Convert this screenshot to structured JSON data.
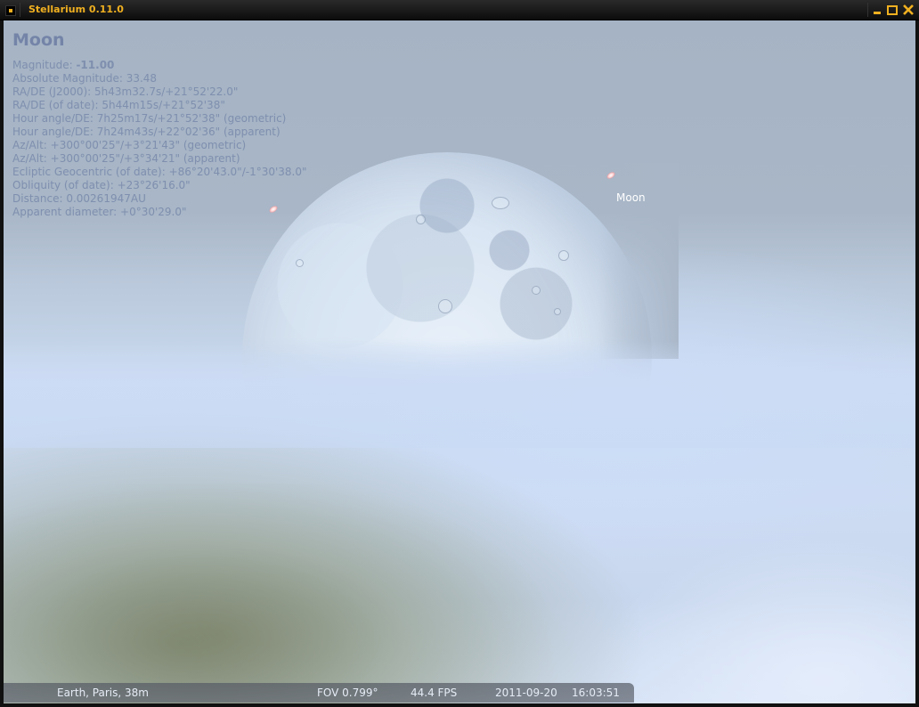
{
  "window": {
    "title": "Stellarium 0.11.0",
    "accent_color": "#f0b020",
    "icons": {
      "app": "app-menu-icon",
      "minimize": "minimize-icon",
      "maximize": "maximize-icon",
      "close": "close-icon"
    }
  },
  "object_info": {
    "name": "Moon",
    "magnitude_label": "Magnitude:",
    "magnitude_value": "-11.00",
    "lines": [
      "Absolute Magnitude: 33.48",
      "RA/DE (J2000): 5h43m32.7s/+21°52'22.0\"",
      "RA/DE (of date): 5h44m15s/+21°52'38\"",
      "Hour angle/DE: 7h25m17s/+21°52'38\" (geometric)",
      "Hour angle/DE: 7h24m43s/+22°02'36\" (apparent)",
      "Az/Alt: +300°00'25\"/+3°21'43\" (geometric)",
      "Az/Alt: +300°00'25\"/+3°34'21\" (apparent)",
      "Ecliptic Geocentric (of date): +86°20'43.0\"/-1°30'38.0\"",
      "Obliquity (of date): +23°26'16.0\"",
      "Distance: 0.00261947AU",
      "Apparent diameter: +0°30'29.0\""
    ],
    "text_color": "#7f8fae"
  },
  "sky": {
    "object_label": "Moon"
  },
  "status_bar": {
    "location": "Earth, Paris, 38m",
    "fov": "FOV 0.799°",
    "fps": "44.4 FPS",
    "date": "2011-09-20",
    "time": "16:03:51"
  }
}
